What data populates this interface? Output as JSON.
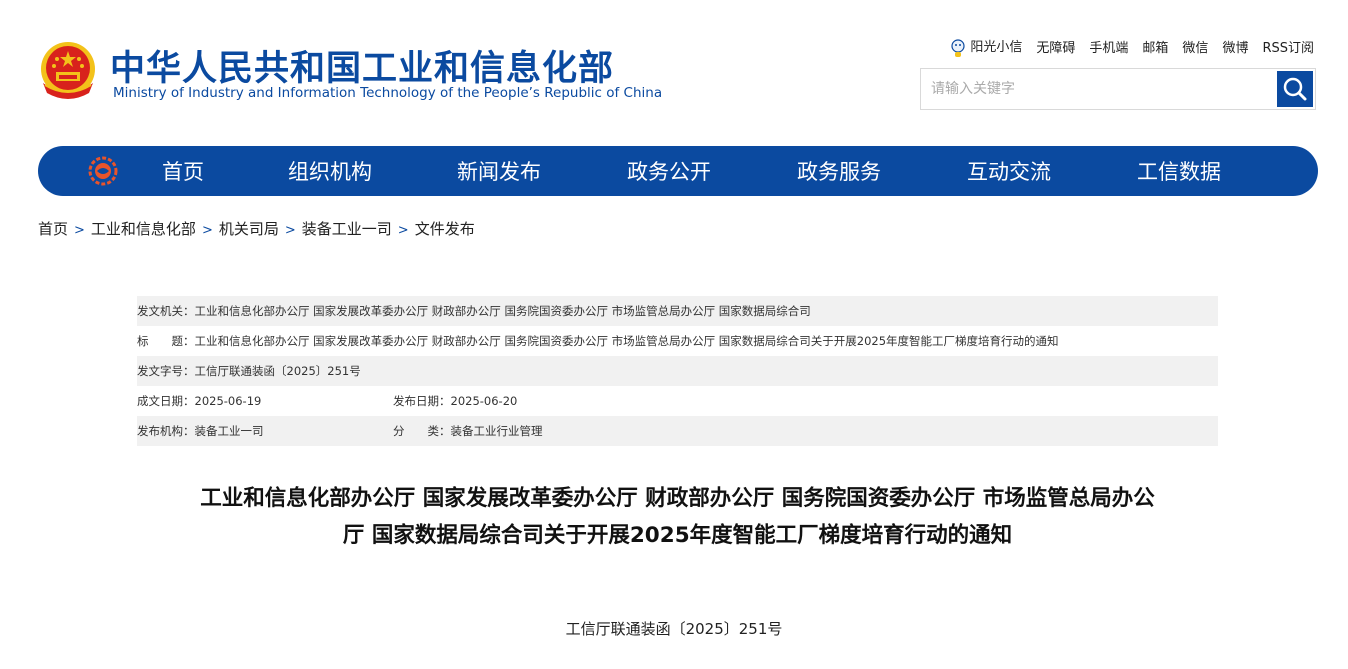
{
  "header": {
    "title_cn": "中华人民共和国工业和信息化部",
    "title_en": "Ministry of Industry and Information Technology of the People’s Republic of China",
    "toplinks": [
      "阳光小信",
      "无障碍",
      "手机端",
      "邮箱",
      "微信",
      "微博",
      "RSS订阅"
    ],
    "search_placeholder": "请输入关键字"
  },
  "nav": {
    "items": [
      "首页",
      "组织机构",
      "新闻发布",
      "政务公开",
      "政务服务",
      "互动交流",
      "工信数据"
    ]
  },
  "breadcrumb": [
    "首页",
    "工业和信息化部",
    "机关司局",
    "装备工业一司",
    "文件发布"
  ],
  "meta": {
    "issuer": "发文机关：工业和信息化部办公厅 国家发展改革委办公厅 财政部办公厅 国务院国资委办公厅 市场监管总局办公厅 国家数据局综合司",
    "title": "标　　题：工业和信息化部办公厅 国家发展改革委办公厅 财政部办公厅 国务院国资委办公厅 市场监管总局办公厅 国家数据局综合司关于开展2025年度智能工厂梯度培育行动的通知",
    "doc_number": "发文字号：工信厅联通装函〔2025〕251号",
    "written_date": "成文日期：2025-06-19",
    "publish_date": "发布日期：2025-06-20",
    "publisher": "发布机构：装备工业一司",
    "category": "分　　类：装备工业行业管理"
  },
  "article": {
    "title_line1": "工业和信息化部办公厅 国家发展改革委办公厅 财政部办公厅 国务院国资委办公厅 市场监管总局办公",
    "title_line2": "厅 国家数据局综合司关于开展2025年度智能工厂梯度培育行动的通知",
    "doc_number": "工信厅联通装函〔2025〕251号"
  },
  "colors": {
    "brand_blue": "#0b4aa0",
    "emblem_red": "#d8221c",
    "emblem_gold": "#f3c21a"
  }
}
